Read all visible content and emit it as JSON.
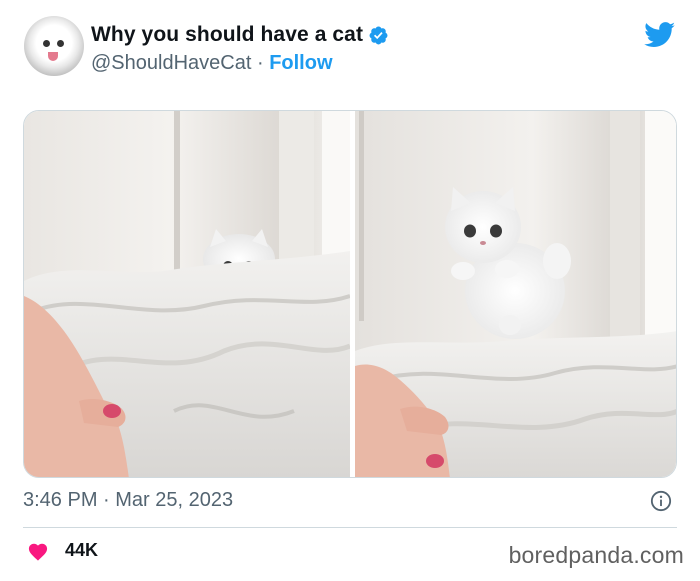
{
  "tweet": {
    "display_name": "Why you should have a cat",
    "handle": "@ShouldHaveCat",
    "separator": "·",
    "follow_label": "Follow",
    "timestamp": "3:46 PM · Mar 25, 2023",
    "like_count": "44K"
  },
  "footer": {
    "watermark": "boredpanda.com"
  },
  "icons": {
    "verified": "verified-badge-icon",
    "brand": "twitter-bird-icon",
    "info": "info-icon",
    "like": "heart-icon"
  },
  "colors": {
    "accent": "#1d9bf0",
    "like": "#f91880",
    "secondary_text": "#536471",
    "divider": "#cfd9de"
  }
}
